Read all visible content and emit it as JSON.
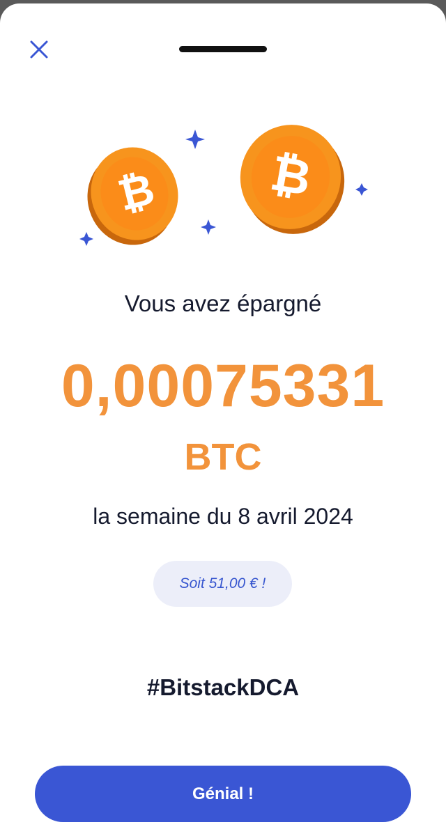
{
  "header": {
    "close_icon": "close-icon"
  },
  "illustration": {
    "coin_left_symbol": "₿",
    "coin_right_symbol": "₿",
    "coin_color": "#f7941d",
    "sparkle_color": "#3a56d4"
  },
  "savings": {
    "title": "Vous avez épargné",
    "amount": "0,00075331",
    "unit": "BTC",
    "period": "la semaine du 8 avril 2024",
    "equivalent": "Soit 51,00 € !"
  },
  "hashtag": "#BitstackDCA",
  "actions": {
    "confirm_label": "Génial !"
  },
  "colors": {
    "accent": "#f2933b",
    "primary": "#3a56d4",
    "text": "#151a2e",
    "badge_bg": "#eceef9"
  }
}
